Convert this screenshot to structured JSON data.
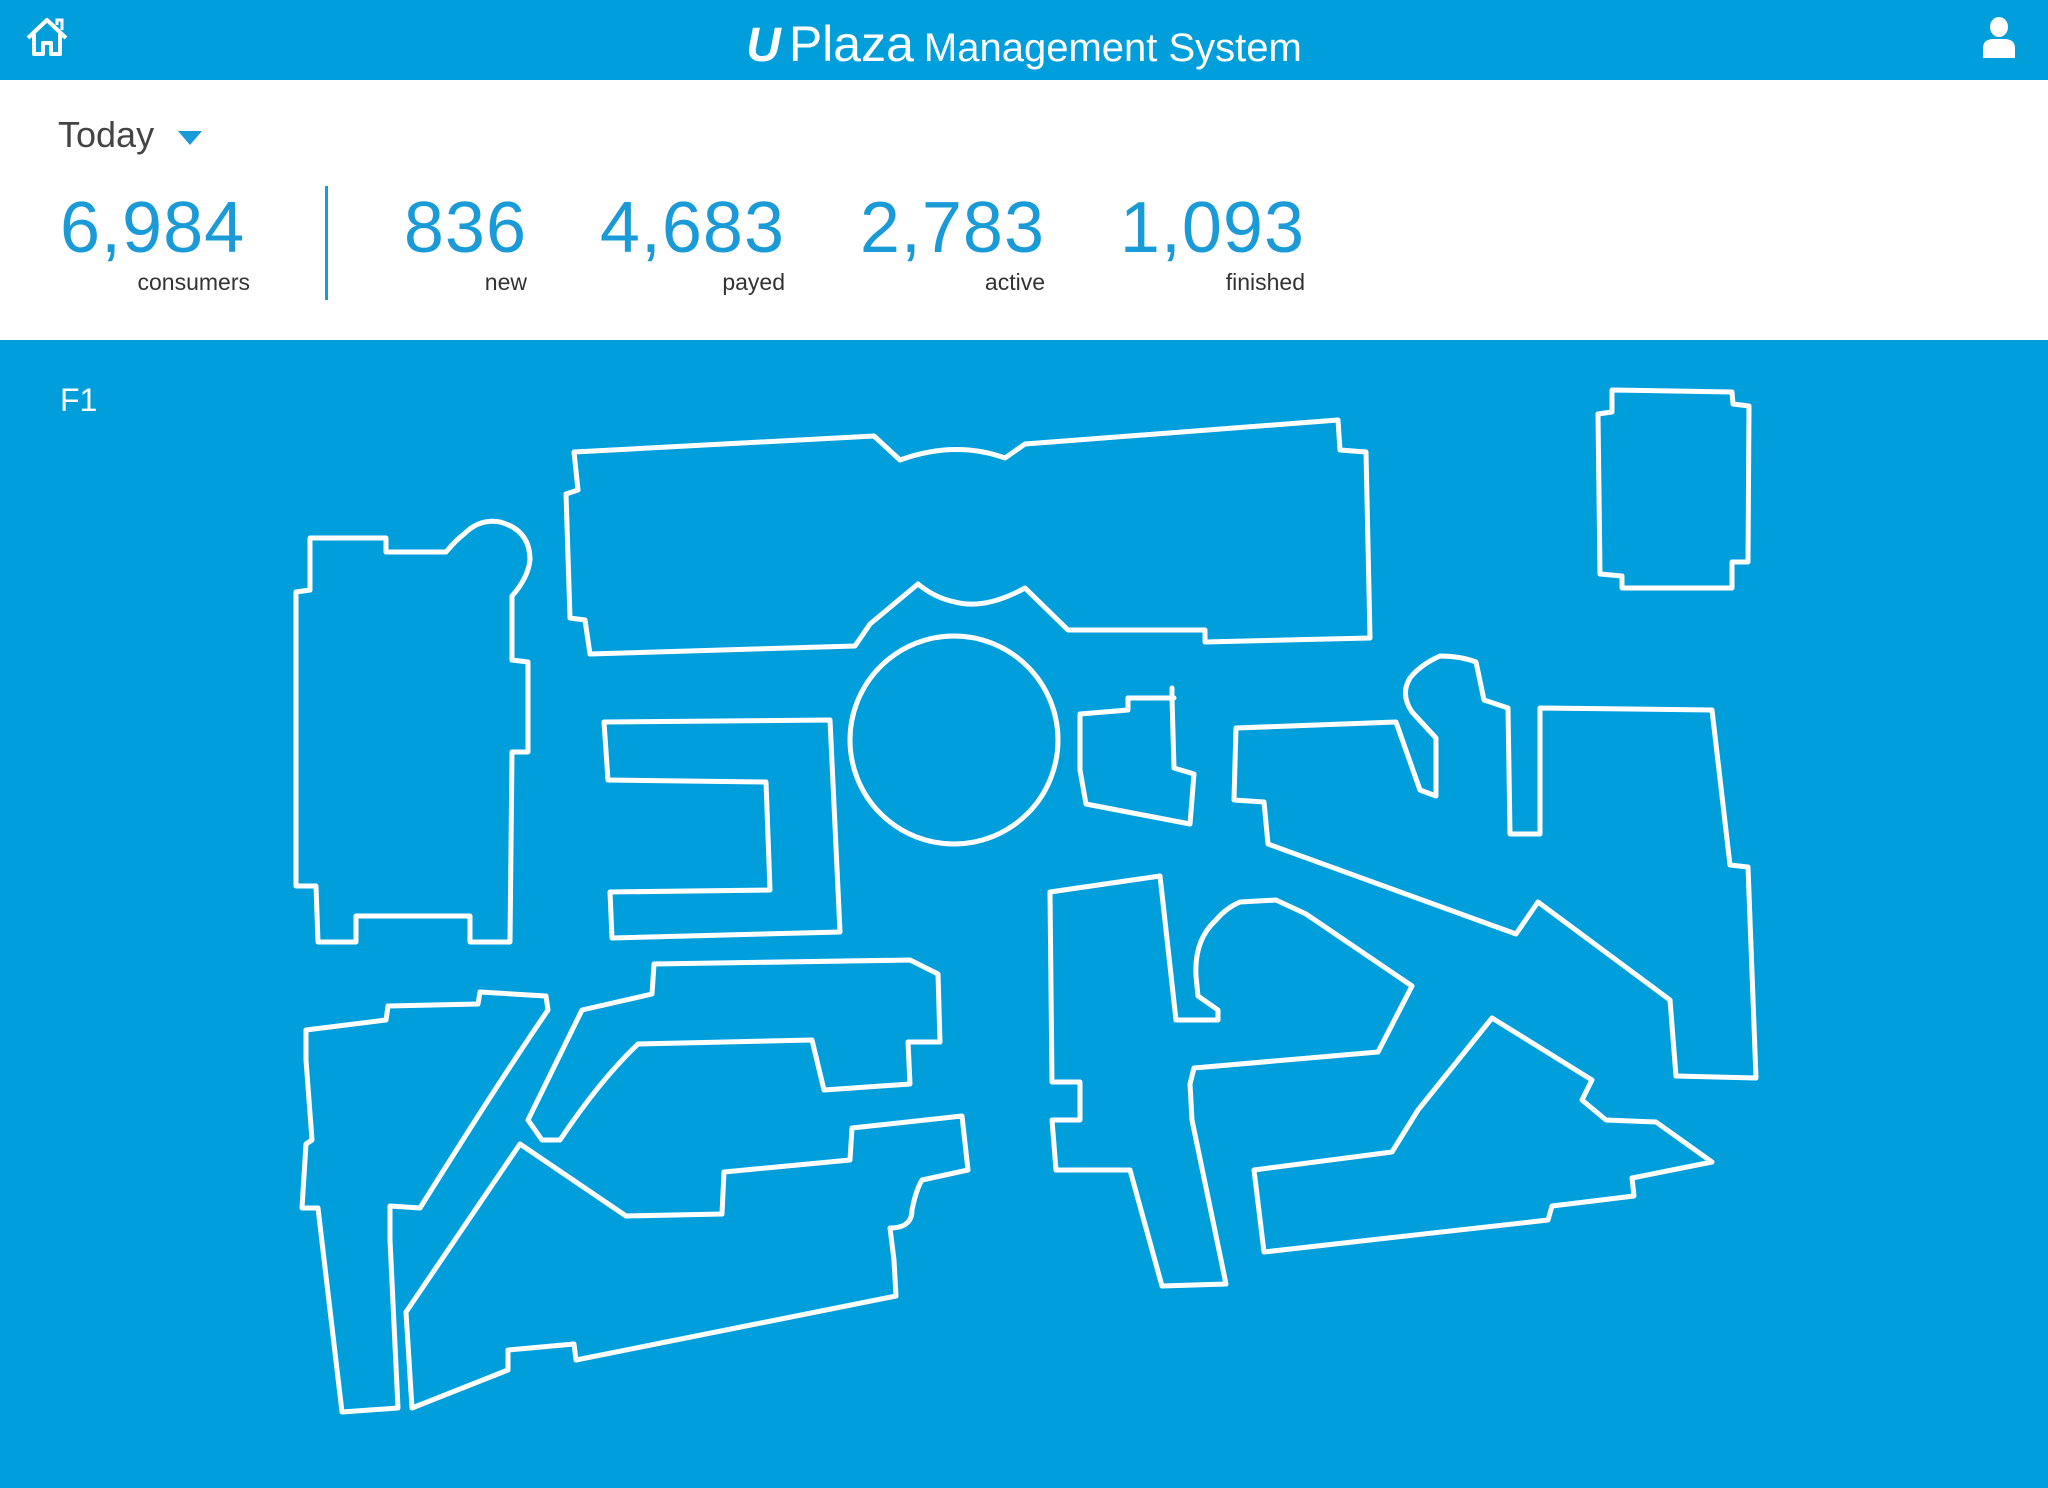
{
  "header": {
    "title_u": "U",
    "title_plaza": "Plaza",
    "title_rest": "Management System",
    "home_icon": "home-icon",
    "user_icon": "user-icon"
  },
  "stats": {
    "period": "Today",
    "items": [
      {
        "value": "6,984",
        "label": "consumers"
      },
      {
        "value": "836",
        "label": "new"
      },
      {
        "value": "4,683",
        "label": "payed"
      },
      {
        "value": "2,783",
        "label": "active"
      },
      {
        "value": "1,093",
        "label": "finished"
      }
    ]
  },
  "map": {
    "floor": "F1"
  },
  "colors": {
    "accent": "#009fdb",
    "number": "#1a9bd7",
    "outline": "#ffffff"
  }
}
